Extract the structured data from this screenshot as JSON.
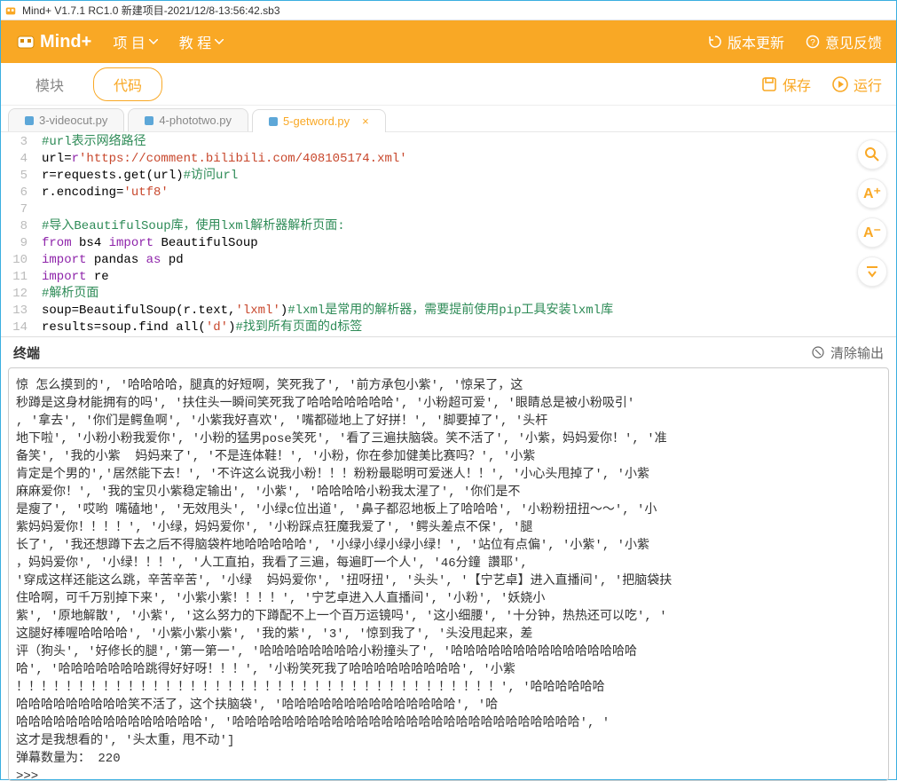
{
  "title": "Mind+ V1.7.1 RC1.0   新建项目-2021/12/8-13:56:42.sb3",
  "brand": "Mind+",
  "menu": {
    "project": "项 目",
    "tutorial": "教 程"
  },
  "right_menu": {
    "update": "版本更新",
    "feedback": "意见反馈"
  },
  "tabs": {
    "module": "模块",
    "code": "代码"
  },
  "actions": {
    "save": "保存",
    "run": "运行"
  },
  "files": [
    {
      "name": "3-videocut.py"
    },
    {
      "name": "4-phototwo.py"
    },
    {
      "name": "5-getword.py"
    }
  ],
  "gutter": [
    "3",
    "4",
    "5",
    "6",
    "7",
    "8",
    "9",
    "10",
    "11",
    "12",
    "13",
    "14"
  ],
  "terminal_title": "终端",
  "clear_label": "清除输出",
  "side": {
    "search": "⦿",
    "aplus": "A⁺",
    "aminus": "A⁻",
    "cn": "⮝"
  },
  "terminal_output": "惊 怎么摸到的', '哈哈哈哈，腿真的好短啊，笑死我了', '前方承包小紫', '惊呆了，这\n秒蹲是这身材能拥有的吗', '扶住头一瞬间笑死我了哈哈哈哈哈哈哈', '小粉超可爱', '眼睛总是被小粉吸引'\n, '拿去', '你们是鳄鱼啊', '小紫我好喜欢', '嘴都碰地上了好拼！', '脚要掉了', '头杆\n地下啦', '小粉小粉我爱你', '小粉的猛男pose笑死', '看了三遍扶脑袋。笑不活了', '小紫，妈妈爱你！', '准\n备笑', '我的小紫  妈妈来了', '不是连体鞋！', '小粉，你在参加健美比赛吗？', '小紫\n肯定是个男的','居然能下去！', '不许这么说我小粉！！！粉粉最聪明可爱迷人！！', '小心头甩掉了', '小紫\n麻麻爱你！', '我的宝贝小紫稳定输出', '小紫', '哈哈哈哈小粉我太湦了', '你们是不\n是瘦了', '哎哟 嘴磕地', '无效甩头', '小绿c位出道', '鼻子都忍地板上了哈哈哈', '小粉粉扭扭～～', '小\n紫妈妈爱你！！！！', '小绿，妈妈爱你', '小粉踩点狂魔我爱了', '鳄头差点不保', '腿\n长了', '我还想蹲下去之后不得脑袋杵地哈哈哈哈哈', '小绿小绿小绿小绿！', '站位有点偏', '小紫', '小紫\n，妈妈爱你', '小绿！！！', '人工直拍，我看了三遍，每遍盯一个人', '46分鐘 讚耶',\n'穿成这样还能这么跳，辛苦辛苦', '小绿  妈妈爱你', '扭呀扭', '头头', '【宁艺卓】进入直播间', '把脑袋扶\n住哈啊，可千万别掉下来', '小紫小紫！！！！', '宁艺卓进入人直播间', '小粉', '妖娆小\n紫', '原地解散', '小紫', '这么努力的下蹲配不上一个百万运镜吗', '这小细腰', '十分钟，热热还可以吃', '\n这腿好棒喔哈哈哈哈', '小紫小紫小紫', '我的紫', '3', '惊到我了', '头没甩起来，差\n评（狗头', '好修长的腿','第一第一', '哈哈哈哈哈哈哈哈小粉撞头了', '哈哈哈哈哈哈哈哈哈哈哈哈哈哈哈\n哈', '哈哈哈哈哈哈哈跳得好好呀！！！', '小粉笑死我了哈哈哈哈哈哈哈哈哈', '小紫\n！！！！！！！！！！！！！！！！！！！！！！！！！！！！！！！！！！！！！！！', '哈哈哈哈哈哈\n哈哈哈哈哈哈哈哈哈笑不活了，这个扶脑袋', '哈哈哈哈哈哈哈哈哈哈哈哈哈哈', '哈\n哈哈哈哈哈哈哈哈哈哈哈哈哈哈哈', '哈哈哈哈哈哈哈哈哈哈哈哈哈哈哈哈哈哈哈哈哈哈哈哈哈哈哈哈', '\n这才是我想看的', '头太重，甩不动']\n弹幕数量为： 220\n>>>_"
}
